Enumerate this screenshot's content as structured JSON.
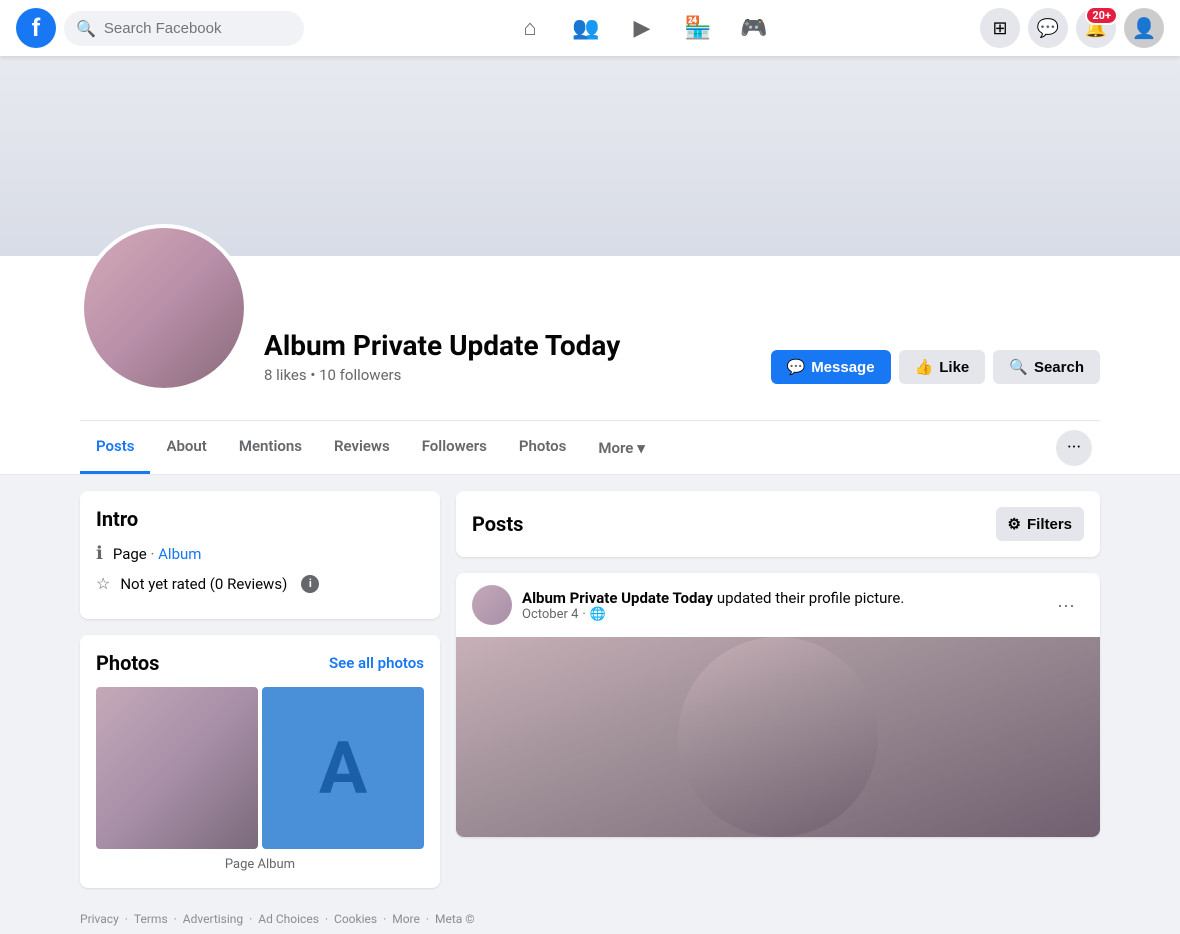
{
  "topnav": {
    "logo": "f",
    "search_placeholder": "Search Facebook",
    "icons": [
      "home",
      "friends",
      "watch",
      "marketplace",
      "gaming"
    ],
    "notif_count": "20+"
  },
  "profile": {
    "name": "Album Private Update Today",
    "likes": "8 likes",
    "followers_count": "10 followers",
    "meta": "8 likes • 10 followers",
    "actions": {
      "message": "Message",
      "like": "Like",
      "search": "Search"
    }
  },
  "tabs": {
    "items": [
      {
        "label": "Posts",
        "active": true
      },
      {
        "label": "About",
        "active": false
      },
      {
        "label": "Mentions",
        "active": false
      },
      {
        "label": "Reviews",
        "active": false
      },
      {
        "label": "Followers",
        "active": false
      },
      {
        "label": "Photos",
        "active": false
      },
      {
        "label": "More",
        "active": false
      }
    ]
  },
  "intro": {
    "title": "Intro",
    "page_label": "Page",
    "album_label": "Album",
    "rating_text": "Not yet rated (0 Reviews)"
  },
  "photos": {
    "title": "Photos",
    "see_all": "See all photos",
    "album_label": "Page Album",
    "letter": "A"
  },
  "posts": {
    "title": "Posts",
    "filters_label": "Filters",
    "post": {
      "author": "Album Private Update Today",
      "action": "updated their profile picture.",
      "date": "October 4",
      "privacy": "🌐"
    }
  },
  "footer": {
    "links": [
      "Privacy",
      "Terms",
      "Advertising",
      "Ad Choices",
      "Cookies",
      "More",
      "Meta ©"
    ]
  }
}
